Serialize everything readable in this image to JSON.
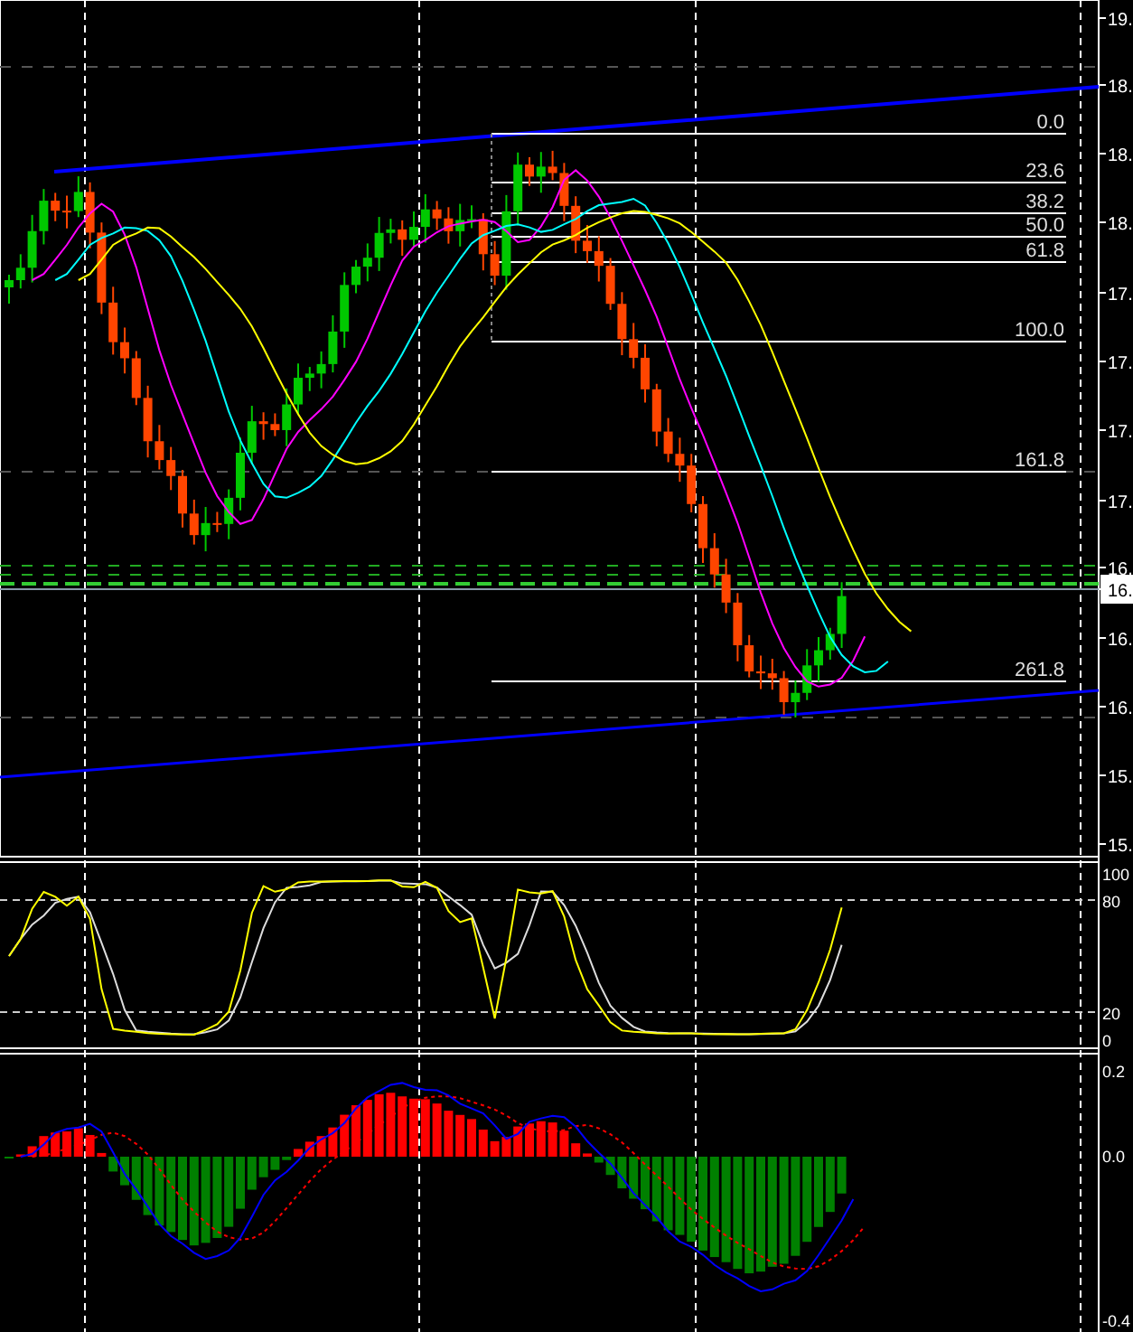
{
  "price_axis": {
    "labels": [
      {
        "text": "19.",
        "current": false
      },
      {
        "text": "18.",
        "current": false
      },
      {
        "text": "18.",
        "current": false
      },
      {
        "text": "18.",
        "current": false
      },
      {
        "text": "17.",
        "current": false
      },
      {
        "text": "17.",
        "current": false
      },
      {
        "text": "17.",
        "current": false
      },
      {
        "text": "17.",
        "current": false
      },
      {
        "text": "16.",
        "current": false
      },
      {
        "text": "16.",
        "current": true
      },
      {
        "text": "16.",
        "current": false
      },
      {
        "text": "16.",
        "current": false
      },
      {
        "text": "15.",
        "current": false
      },
      {
        "text": "15.",
        "current": false
      }
    ]
  },
  "fibonacci_levels": [
    "0.0",
    "23.6",
    "38.2",
    "50.0",
    "61.8",
    "100.0",
    "161.8",
    "261.8"
  ],
  "stochastic_axis": {
    "labels": [
      "100",
      "80",
      "20",
      "0"
    ]
  },
  "macd_axis": {
    "labels": [
      "0.2",
      "0.0",
      "-0.4"
    ]
  }
}
